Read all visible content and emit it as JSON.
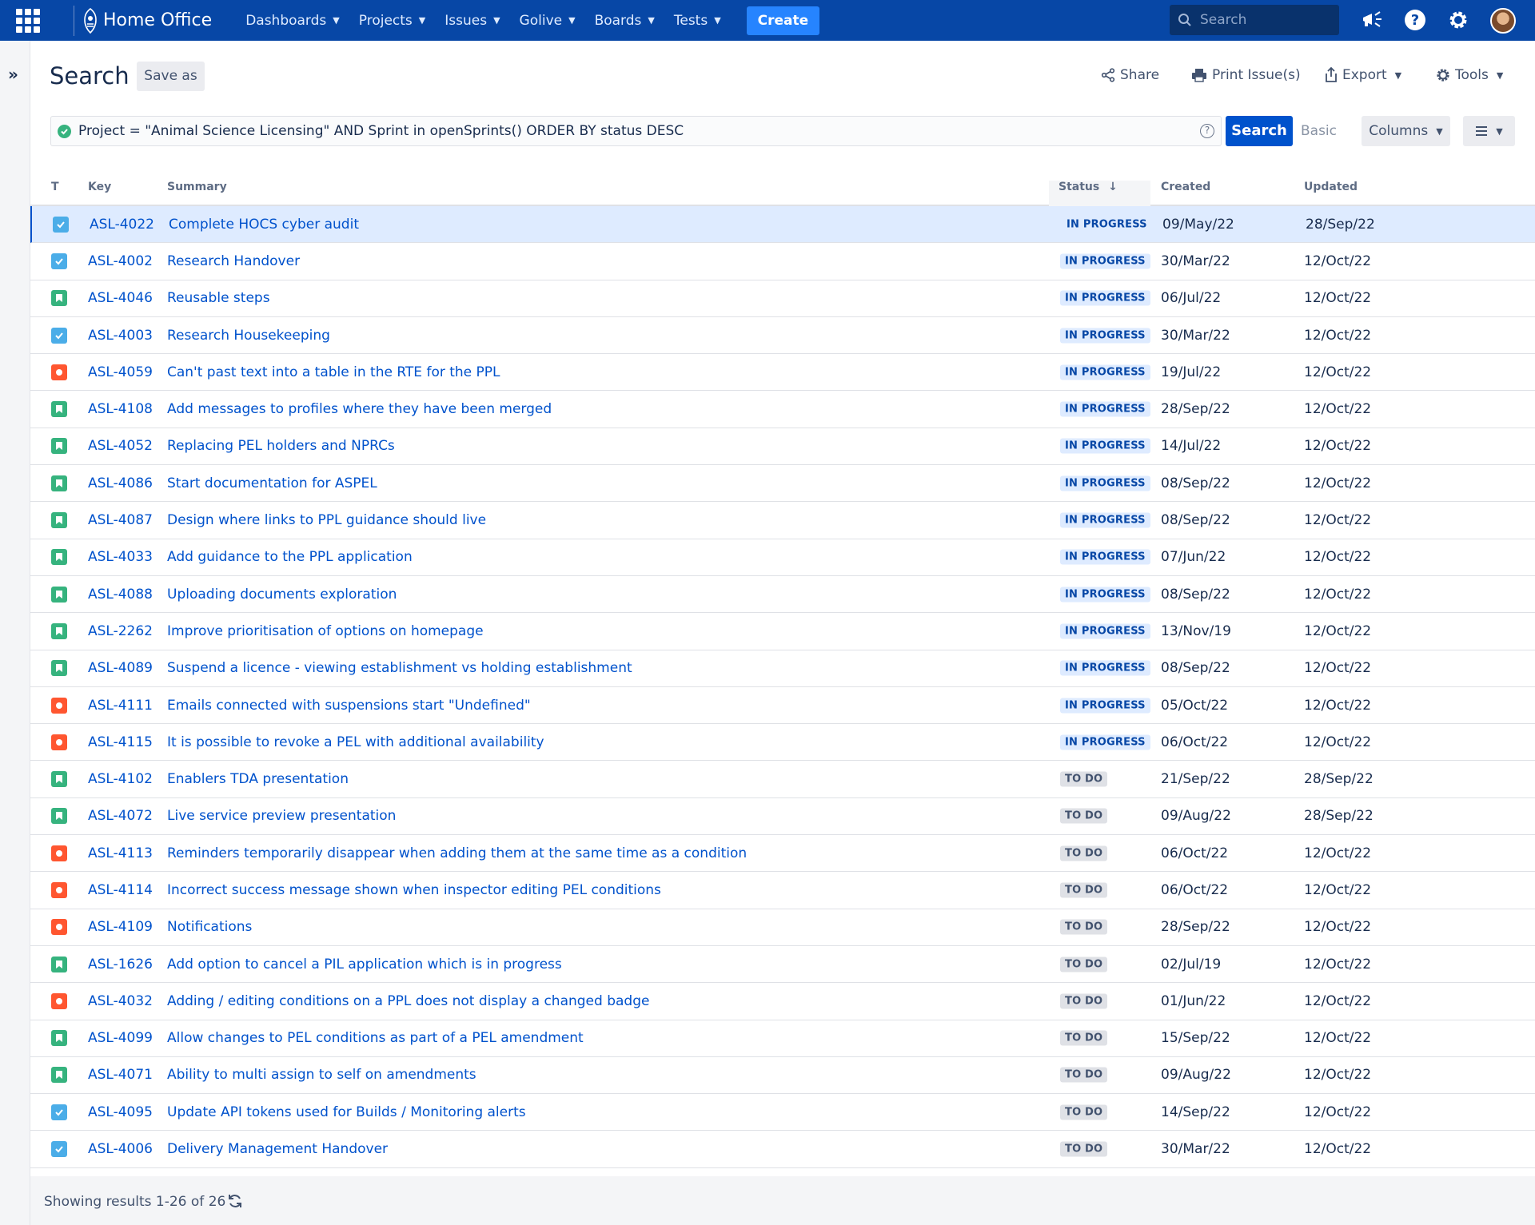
{
  "nav": {
    "brand": "Home Office",
    "menu": [
      {
        "label": "Dashboards"
      },
      {
        "label": "Projects"
      },
      {
        "label": "Issues"
      },
      {
        "label": "Golive"
      },
      {
        "label": "Boards"
      },
      {
        "label": "Tests"
      }
    ],
    "create_label": "Create",
    "search_placeholder": "Search"
  },
  "header": {
    "title": "Search",
    "save_as": "Save as",
    "share": "Share",
    "print": "Print Issue(s)",
    "export": "Export",
    "tools": "Tools"
  },
  "jql": {
    "query": "Project = \"Animal Science Licensing\"  AND Sprint in openSprints() ORDER BY status DESC",
    "search_label": "Search",
    "basic_label": "Basic",
    "columns_label": "Columns"
  },
  "table": {
    "headers": {
      "type": "T",
      "key": "Key",
      "summary": "Summary",
      "status": "Status",
      "created": "Created",
      "updated": "Updated"
    },
    "rows": [
      {
        "type": "task",
        "key": "ASL-4022",
        "summary": "Complete HOCS cyber audit",
        "status": "IN PROGRESS",
        "created": "09/May/22",
        "updated": "28/Sep/22"
      },
      {
        "type": "task",
        "key": "ASL-4002",
        "summary": "Research Handover",
        "status": "IN PROGRESS",
        "created": "30/Mar/22",
        "updated": "12/Oct/22"
      },
      {
        "type": "story",
        "key": "ASL-4046",
        "summary": "Reusable steps",
        "status": "IN PROGRESS",
        "created": "06/Jul/22",
        "updated": "12/Oct/22"
      },
      {
        "type": "task",
        "key": "ASL-4003",
        "summary": "Research Housekeeping",
        "status": "IN PROGRESS",
        "created": "30/Mar/22",
        "updated": "12/Oct/22"
      },
      {
        "type": "bug",
        "key": "ASL-4059",
        "summary": "Can't past text into a table in the RTE for the PPL",
        "status": "IN PROGRESS",
        "created": "19/Jul/22",
        "updated": "12/Oct/22"
      },
      {
        "type": "story",
        "key": "ASL-4108",
        "summary": "Add messages to profiles where they have been merged",
        "status": "IN PROGRESS",
        "created": "28/Sep/22",
        "updated": "12/Oct/22"
      },
      {
        "type": "story",
        "key": "ASL-4052",
        "summary": "Replacing PEL holders and NPRCs",
        "status": "IN PROGRESS",
        "created": "14/Jul/22",
        "updated": "12/Oct/22"
      },
      {
        "type": "story",
        "key": "ASL-4086",
        "summary": "Start documentation for ASPEL",
        "status": "IN PROGRESS",
        "created": "08/Sep/22",
        "updated": "12/Oct/22"
      },
      {
        "type": "story",
        "key": "ASL-4087",
        "summary": "Design where links to PPL guidance should live",
        "status": "IN PROGRESS",
        "created": "08/Sep/22",
        "updated": "12/Oct/22"
      },
      {
        "type": "story",
        "key": "ASL-4033",
        "summary": "Add guidance to the PPL application",
        "status": "IN PROGRESS",
        "created": "07/Jun/22",
        "updated": "12/Oct/22"
      },
      {
        "type": "story",
        "key": "ASL-4088",
        "summary": "Uploading documents exploration",
        "status": "IN PROGRESS",
        "created": "08/Sep/22",
        "updated": "12/Oct/22"
      },
      {
        "type": "story",
        "key": "ASL-2262",
        "summary": "Improve prioritisation of options on homepage",
        "status": "IN PROGRESS",
        "created": "13/Nov/19",
        "updated": "12/Oct/22"
      },
      {
        "type": "story",
        "key": "ASL-4089",
        "summary": "Suspend a licence - viewing establishment vs holding establishment",
        "status": "IN PROGRESS",
        "created": "08/Sep/22",
        "updated": "12/Oct/22"
      },
      {
        "type": "bug",
        "key": "ASL-4111",
        "summary": "Emails connected with suspensions start \"Undefined\"",
        "status": "IN PROGRESS",
        "created": "05/Oct/22",
        "updated": "12/Oct/22"
      },
      {
        "type": "bug",
        "key": "ASL-4115",
        "summary": "It is possible to revoke a PEL with additional availability",
        "status": "IN PROGRESS",
        "created": "06/Oct/22",
        "updated": "12/Oct/22"
      },
      {
        "type": "story",
        "key": "ASL-4102",
        "summary": "Enablers TDA presentation",
        "status": "TO DO",
        "created": "21/Sep/22",
        "updated": "28/Sep/22"
      },
      {
        "type": "story",
        "key": "ASL-4072",
        "summary": "Live service preview presentation",
        "status": "TO DO",
        "created": "09/Aug/22",
        "updated": "28/Sep/22"
      },
      {
        "type": "bug",
        "key": "ASL-4113",
        "summary": "Reminders temporarily disappear when adding them at the same time as a condition",
        "status": "TO DO",
        "created": "06/Oct/22",
        "updated": "12/Oct/22"
      },
      {
        "type": "bug",
        "key": "ASL-4114",
        "summary": "Incorrect success message shown when inspector editing PEL conditions",
        "status": "TO DO",
        "created": "06/Oct/22",
        "updated": "12/Oct/22"
      },
      {
        "type": "bug",
        "key": "ASL-4109",
        "summary": "Notifications",
        "status": "TO DO",
        "created": "28/Sep/22",
        "updated": "12/Oct/22"
      },
      {
        "type": "story",
        "key": "ASL-1626",
        "summary": "Add option to cancel a PIL application which is in progress",
        "status": "TO DO",
        "created": "02/Jul/19",
        "updated": "12/Oct/22"
      },
      {
        "type": "bug",
        "key": "ASL-4032",
        "summary": "Adding / editing conditions on a PPL does not display a changed badge",
        "status": "TO DO",
        "created": "01/Jun/22",
        "updated": "12/Oct/22"
      },
      {
        "type": "story",
        "key": "ASL-4099",
        "summary": "Allow changes to PEL conditions as part of a PEL amendment",
        "status": "TO DO",
        "created": "15/Sep/22",
        "updated": "12/Oct/22"
      },
      {
        "type": "story",
        "key": "ASL-4071",
        "summary": "Ability to multi assign to self on amendments",
        "status": "TO DO",
        "created": "09/Aug/22",
        "updated": "12/Oct/22"
      },
      {
        "type": "task",
        "key": "ASL-4095",
        "summary": "Update API tokens used for Builds / Monitoring alerts",
        "status": "TO DO",
        "created": "14/Sep/22",
        "updated": "12/Oct/22"
      },
      {
        "type": "task",
        "key": "ASL-4006",
        "summary": "Delivery Management Handover",
        "status": "TO DO",
        "created": "30/Mar/22",
        "updated": "12/Oct/22"
      }
    ]
  },
  "footer": {
    "results": "Showing results 1-26 of 26"
  }
}
